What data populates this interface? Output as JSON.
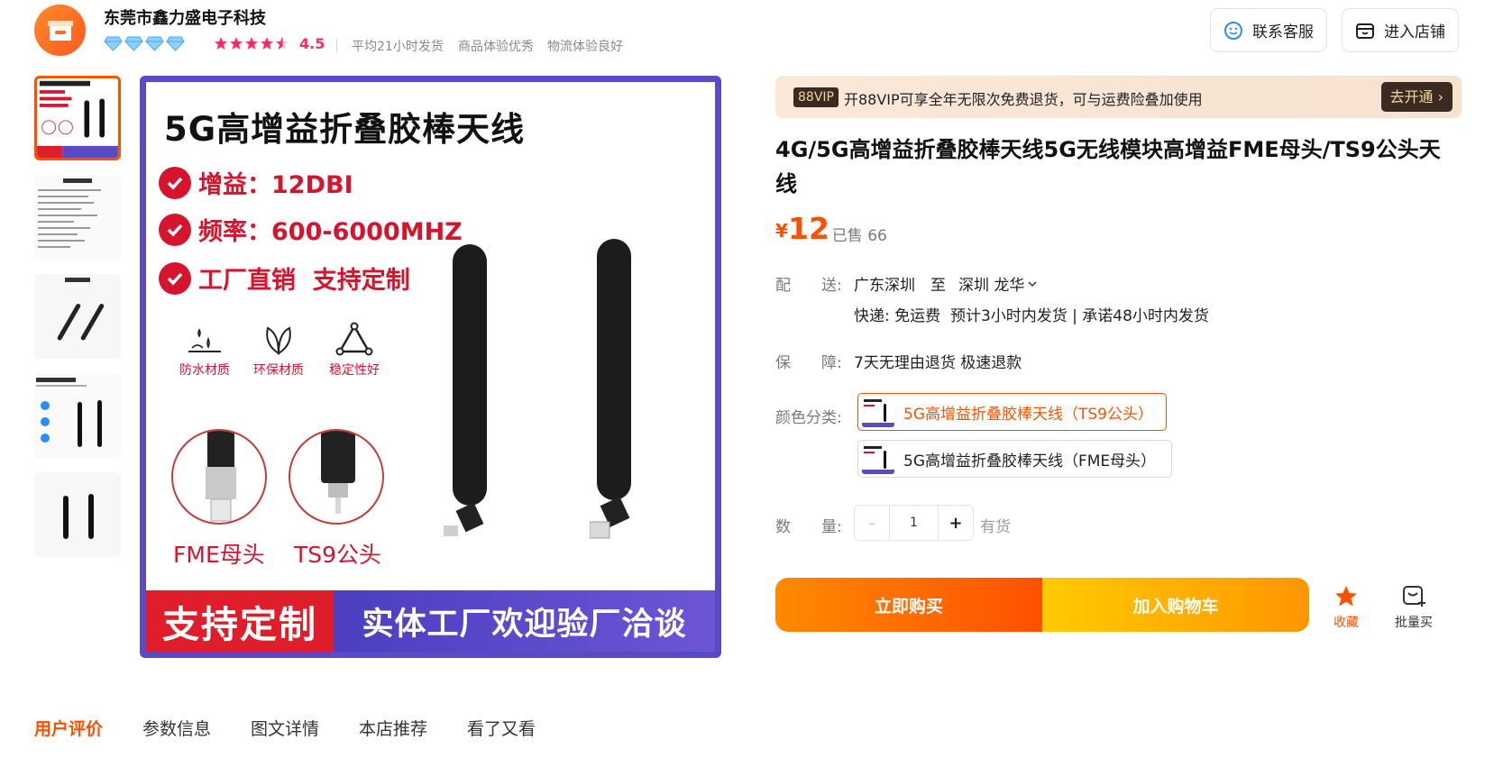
{
  "shop": {
    "name": "东莞市鑫力盛电子科技",
    "rating": "4.5",
    "tags": [
      "平均21小时发货",
      "商品体验优秀",
      "物流体验良好"
    ],
    "contact_label": "联系客服",
    "store_label": "进入店铺"
  },
  "image": {
    "title": "5G高增益折叠胶棒天线",
    "features": [
      "增益：12DBI",
      "频率：600-6000MHZ",
      "工厂直销  支持定制"
    ],
    "properties": [
      "防水材质",
      "环保材质",
      "稳定性好"
    ],
    "connectors": [
      "FME母头",
      "TS9公头"
    ],
    "banner_left": "支持定制",
    "banner_right": "实体工厂欢迎验厂洽谈"
  },
  "vip": {
    "badge": "88VIP",
    "text": "开88VIP可享全年无限次免费退货，可与运费险叠加使用",
    "button": "去开通 ›"
  },
  "product": {
    "title": "4G/5G高增益折叠胶棒天线5G无线模块高增益FME母头/TS9公头天线",
    "currency": "¥",
    "price": "12",
    "sold": "· 已售 66"
  },
  "delivery": {
    "label": "配　　送:",
    "from": "广东深圳",
    "to_word": "至",
    "to": "深圳 龙华",
    "detail": "快递: 免运费  预计3小时内发货 | 承诺48小时内发货"
  },
  "guarantee": {
    "label": "保　　障:",
    "text": "7天无理由退货 极速退款"
  },
  "color": {
    "label": "颜色分类:",
    "options": [
      "5G高增益折叠胶棒天线（TS9公头）",
      "5G高增益折叠胶棒天线（FME母头）"
    ]
  },
  "quantity": {
    "label": "数　　量:",
    "minus": "-",
    "value": "1",
    "plus": "+",
    "stock": "有货"
  },
  "actions": {
    "buy_now": "立即购买",
    "add_cart": "加入购物车",
    "favorite": "收藏",
    "bulk": "批量买"
  },
  "tabs": [
    "用户评价",
    "参数信息",
    "图文详情",
    "本店推荐",
    "看了又看"
  ],
  "colors": {
    "accent": "#ff5000",
    "rating": "#ff2b5e",
    "image_border": "#5b4ac6",
    "image_red": "#d6142d"
  }
}
